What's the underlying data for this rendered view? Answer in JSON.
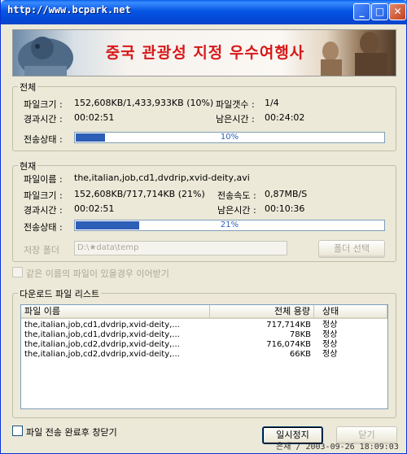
{
  "window": {
    "title": "http://www.bcpark.net",
    "banner_text": "중국 관광성 지정 우수여행사"
  },
  "total": {
    "section_title": "전체",
    "file_size_label": "파일크기 :",
    "file_size_value": "152,608KB/1,433,933KB (10%)",
    "file_count_label": "파일갯수 :",
    "file_count_value": "1/4",
    "elapsed_label": "경과시간 :",
    "elapsed_value": "00:02:51",
    "remaining_label": "남은시간 :",
    "remaining_value": "00:24:02",
    "status_label": "전송상태 :",
    "progress_text": "10%",
    "progress": 0.1
  },
  "current": {
    "section_title": "현재",
    "file_name_label": "파일이름 :",
    "file_name_value": "the,italian,job,cd1,dvdrip,xvid-deity,avi",
    "file_size_label": "파일크기 :",
    "file_size_value": "152,608KB/717,714KB (21%)",
    "speed_label": "전송속도 :",
    "speed_value": "0,87MB/S",
    "elapsed_label": "경과시간 :",
    "elapsed_value": "00:02:51",
    "remaining_label": "남은시간 :",
    "remaining_value": "00:10:36",
    "status_label": "전송상태 :",
    "progress_text": "21%",
    "progress": 0.21,
    "save_folder_label": "저장 폴더",
    "save_folder_value": "D:\\★data\\temp",
    "folder_select_button": "폴더 선택"
  },
  "resume_checkbox_label": "같은 이름의 파일이 있을경우 이어받기",
  "download_list": {
    "section_title": "다운로드 파일 리스트",
    "columns": [
      "파일 이름",
      "전체 용량",
      "상태"
    ],
    "rows": [
      {
        "name": "the,italian,job,cd1,dvdrip,xvid-deity,...",
        "size": "717,714KB",
        "state": "정상"
      },
      {
        "name": "the,italian,job,cd1,dvdrip,xvid-deity,...",
        "size": "78KB",
        "state": "정상"
      },
      {
        "name": "the,italian,job,cd2,dvdrip,xvid-deity,...",
        "size": "716,074KB",
        "state": "정상"
      },
      {
        "name": "the,italian,job,cd2,dvdrip,xvid-deity,...",
        "size": "66KB",
        "state": "정상"
      }
    ]
  },
  "close_on_complete_label": "파일 전송 완료후 창닫기",
  "pause_button": "일시정지",
  "close_button": "닫기",
  "watermark": "은재 / 2003-09-26 18:09:03"
}
